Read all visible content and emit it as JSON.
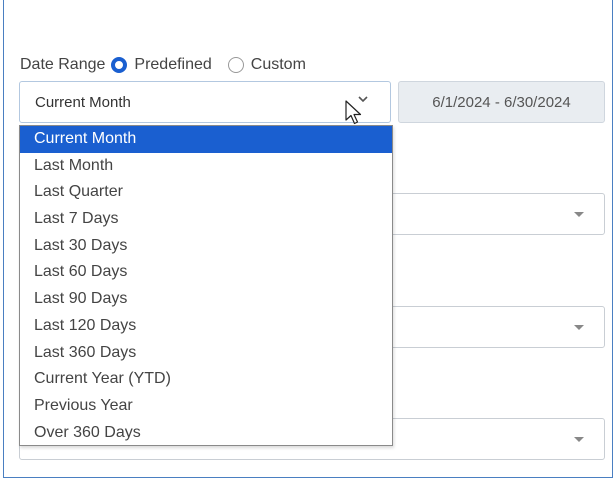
{
  "date_range": {
    "label": "Date Range",
    "options": [
      {
        "label": "Predefined",
        "checked": true
      },
      {
        "label": "Custom",
        "checked": false
      }
    ]
  },
  "predefined_select": {
    "value": "Current Month",
    "items": [
      "Current Month",
      "Last Month",
      "Last Quarter",
      "Last 7 Days",
      "Last 30 Days",
      "Last 60 Days",
      "Last 90 Days",
      "Last 120 Days",
      "Last 360 Days",
      "Current Year (YTD)",
      "Previous Year",
      "Over 360 Days"
    ],
    "selected_index": 0
  },
  "date_display": "6/1/2024 - 6/30/2024",
  "colors": {
    "accent": "#1a5fd0",
    "panel_border": "#4a7fc1"
  },
  "icons": {
    "chevron": "chevron-down-icon",
    "cursor": "mouse-pointer-icon",
    "caret": "caret-down-icon"
  }
}
